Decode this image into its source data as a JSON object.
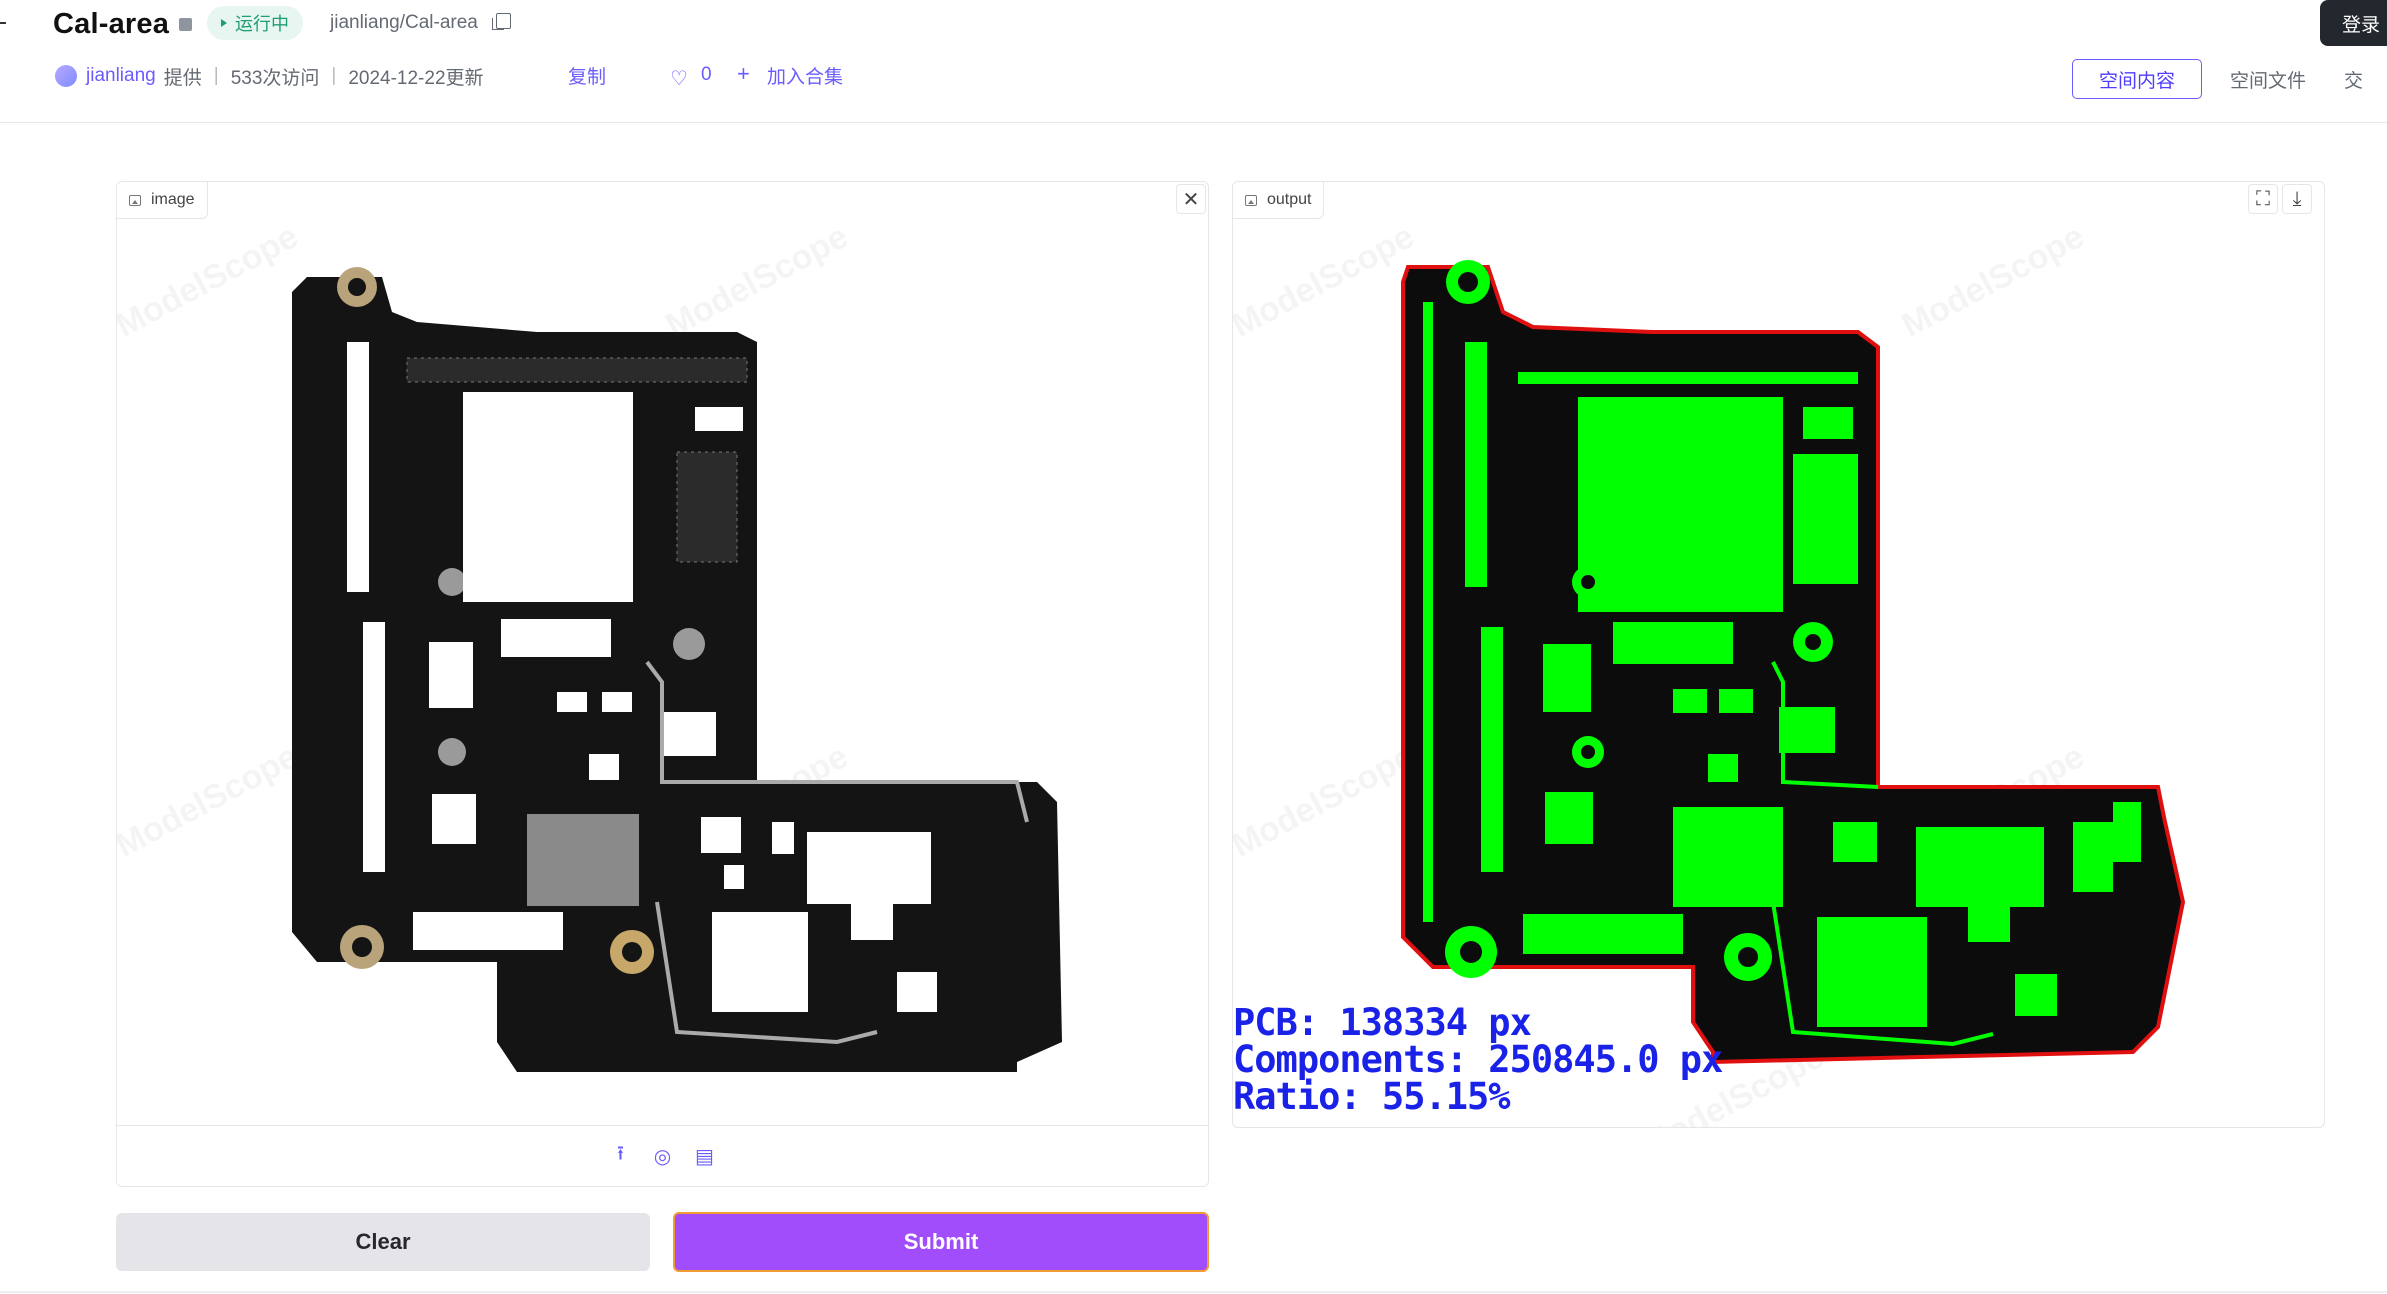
{
  "header": {
    "title": "Cal-area",
    "status": "运行中",
    "repo_path": "jianliang/Cal-area",
    "login_label": "登录"
  },
  "meta": {
    "author": "jianliang",
    "provided": "提供",
    "visits": "533次访问",
    "updated": "2024-12-22更新",
    "copy_label": "复制",
    "likes": "0",
    "add_collection": "加入合集"
  },
  "tabs": [
    "空间内容",
    "空间文件",
    "交"
  ],
  "input_panel": {
    "label": "image"
  },
  "output_panel": {
    "label": "output",
    "pcb_line": "PCB: 138334 px",
    "components_line": "Components: 250845.0 px",
    "ratio_line": "Ratio: 55.15%"
  },
  "watermark": "ModelScope",
  "buttons": {
    "clear": "Clear",
    "submit": "Submit"
  },
  "colors": {
    "accent": "#6b5cff",
    "submit": "#a24dfb",
    "status_bg": "#e7f6f1",
    "status_fg": "#1f9e74",
    "component_mask": "#00ff00",
    "pcb_outline": "#e01010",
    "readout_text": "#1a22e8"
  },
  "icons": [
    "pause-icon",
    "copy-icon",
    "avatar",
    "heart-icon",
    "plus-icon",
    "image-icon",
    "close-icon",
    "fullscreen-icon",
    "download-icon",
    "upload-icon",
    "webcam-icon",
    "clipboard-icon"
  ]
}
